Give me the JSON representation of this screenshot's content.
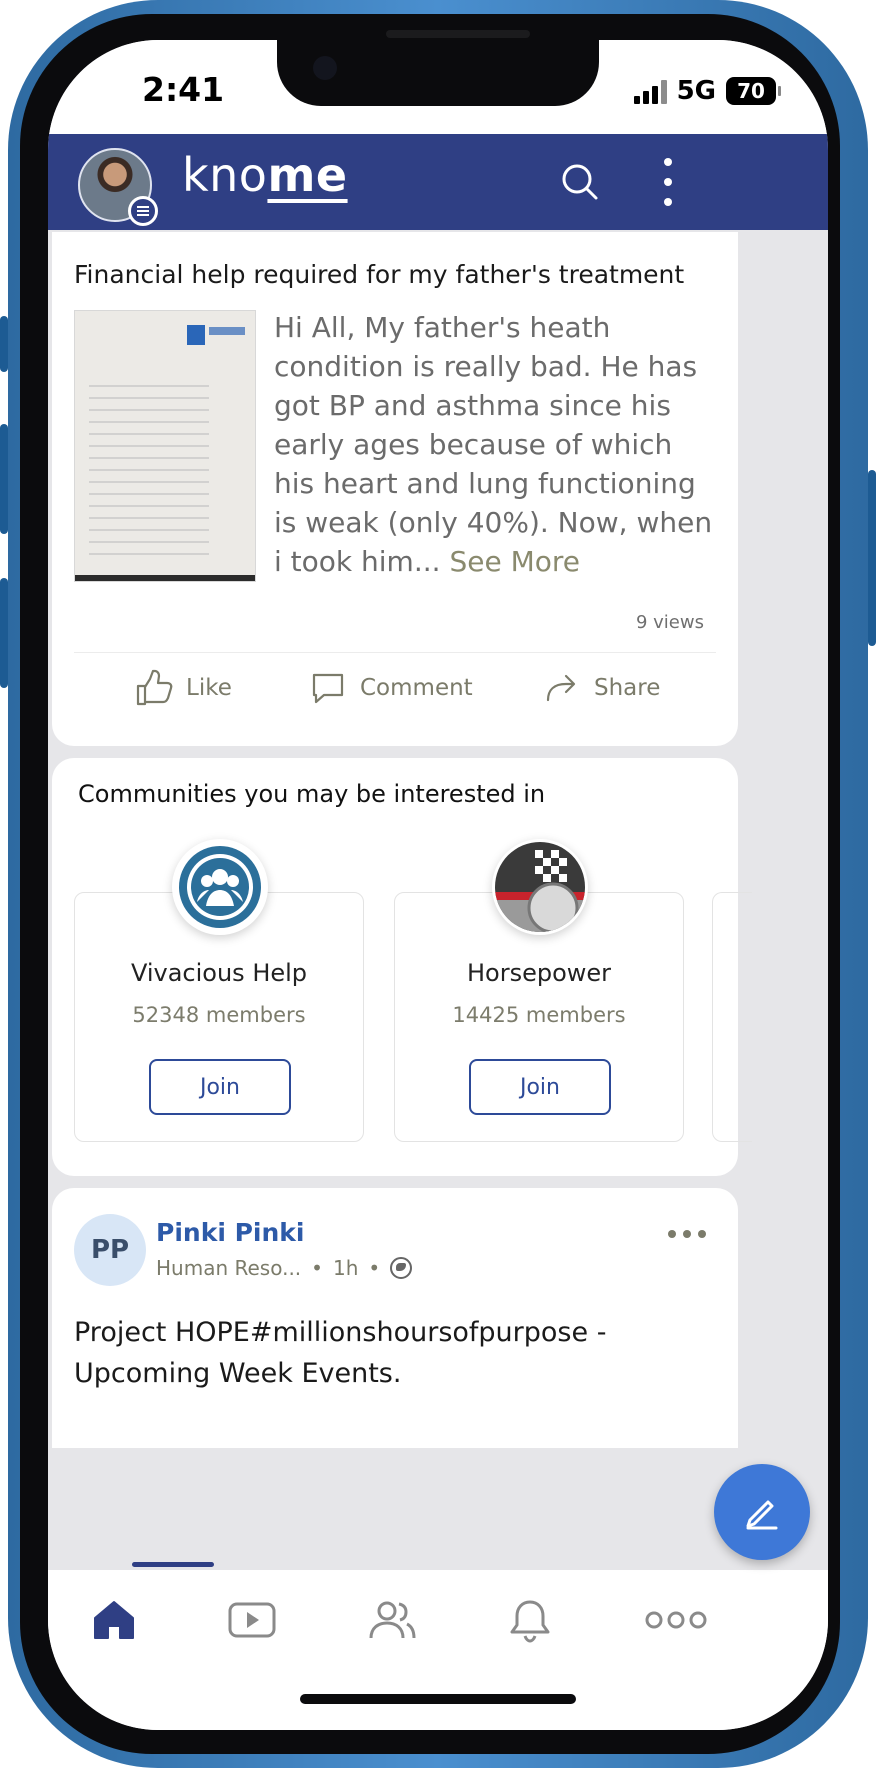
{
  "status_bar": {
    "time": "2:41",
    "network": "5G",
    "battery": "70"
  },
  "header": {
    "brand_prefix": "kno",
    "brand_suffix": "me",
    "icons": [
      "search-icon",
      "more-vertical-icon",
      "menu-icon"
    ]
  },
  "post1": {
    "title": "Financial help required for my father's treatment",
    "body": "Hi All, My father's heath condition is really bad. He has got BP and asthma since his early ages because of which his heart and lung functioning is weak (only 40%). Now, when i took him...",
    "see_more": "See More",
    "views": "9 views",
    "actions": {
      "like": "Like",
      "comment": "Comment",
      "share": "Share"
    }
  },
  "communities": {
    "title": "Communities you may be interested in",
    "items": [
      {
        "name": "Vivacious Help",
        "members": "52348 members",
        "join": "Join",
        "icon": "group-icon"
      },
      {
        "name": "Horsepower",
        "members": "14425 members",
        "join": "Join",
        "icon": "racing-flag-icon"
      }
    ]
  },
  "post2": {
    "initials": "PP",
    "author": "Pinki Pinki",
    "role": "Human Reso...",
    "time": "1h",
    "text": "Project HOPE#millionshoursofpurpose - Upcoming Week Events."
  },
  "bottom_nav": {
    "items": [
      "home-icon",
      "video-icon",
      "people-icon",
      "bell-icon",
      "more-horizontal-icon"
    ],
    "active": "home-icon"
  },
  "colors": {
    "brand": "#2f3f84",
    "fab": "#3e78d7",
    "link": "#2d5aa8",
    "frame": "#2e6aa1"
  }
}
